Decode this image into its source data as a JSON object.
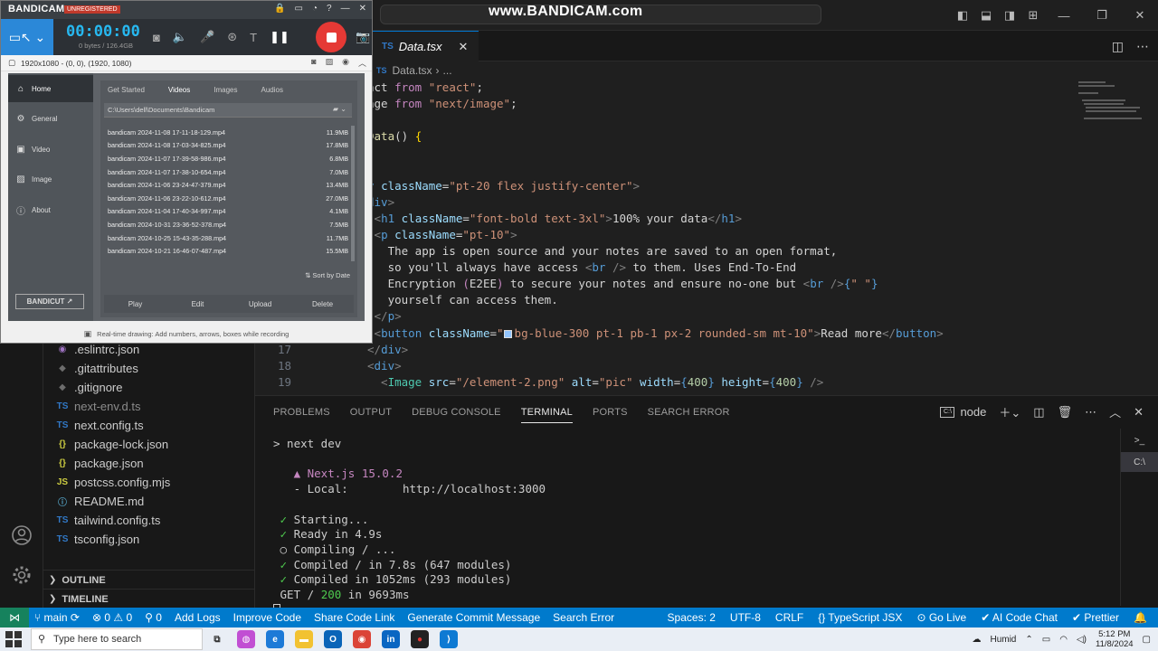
{
  "watermark": "www.BANDICAM.com",
  "vscode": {
    "tab": {
      "icon": "TS",
      "label": "Data.tsx",
      "close": "✕"
    },
    "breadcrumb": {
      "icon": "TS",
      "file": "Data.tsx",
      "sep": "›",
      "rest": "..."
    },
    "code": [
      {
        "n": "",
        "parts": [
          {
            "t": "act ",
            "c": "txt"
          },
          {
            "t": "from ",
            "c": "kw2"
          },
          {
            "t": "\"react\"",
            "c": "str"
          },
          {
            "t": ";",
            "c": "txt"
          }
        ]
      },
      {
        "n": "",
        "parts": [
          {
            "t": "age ",
            "c": "txt"
          },
          {
            "t": "from ",
            "c": "kw2"
          },
          {
            "t": "\"next/image\"",
            "c": "str"
          },
          {
            "t": ";",
            "c": "txt"
          }
        ]
      },
      {
        "n": "",
        "parts": []
      },
      {
        "n": "",
        "parts": [
          {
            "t": "Data",
            "c": "fn"
          },
          {
            "t": "() ",
            "c": "txt"
          },
          {
            "t": "{",
            "c": "br"
          }
        ]
      },
      {
        "n": "",
        "parts": [
          {
            "t": "(",
            "c": "kw2"
          }
        ]
      },
      {
        "n": "",
        "parts": []
      },
      {
        "n": "",
        "parts": [
          {
            "t": "v ",
            "c": "tag"
          },
          {
            "t": "className",
            "c": "attr"
          },
          {
            "t": "=",
            "c": "txt"
          },
          {
            "t": "\"pt-20 flex justify-center\"",
            "c": "str"
          },
          {
            "t": ">",
            "c": "gray"
          }
        ]
      },
      {
        "n": "",
        "parts": [
          {
            "t": "div",
            "c": "tag"
          },
          {
            "t": ">",
            "c": "gray"
          }
        ]
      },
      {
        "n": "",
        "parts": [
          {
            "t": " <",
            "c": "gray"
          },
          {
            "t": "h1 ",
            "c": "tag"
          },
          {
            "t": "className",
            "c": "attr"
          },
          {
            "t": "=",
            "c": "txt"
          },
          {
            "t": "\"font-bold text-3xl\"",
            "c": "str"
          },
          {
            "t": ">",
            "c": "gray"
          },
          {
            "t": "100% your data",
            "c": "txt"
          },
          {
            "t": "</",
            "c": "gray"
          },
          {
            "t": "h1",
            "c": "tag"
          },
          {
            "t": ">",
            "c": "gray"
          }
        ]
      },
      {
        "n": "",
        "parts": [
          {
            "t": " <",
            "c": "gray"
          },
          {
            "t": "p ",
            "c": "tag"
          },
          {
            "t": "className",
            "c": "attr"
          },
          {
            "t": "=",
            "c": "txt"
          },
          {
            "t": "\"pt-10\"",
            "c": "str"
          },
          {
            "t": ">",
            "c": "gray"
          }
        ]
      },
      {
        "n": "",
        "parts": [
          {
            "t": "   The app is open source and your notes are saved to an open format,",
            "c": "txt"
          }
        ]
      },
      {
        "n": "",
        "parts": [
          {
            "t": "   so you'll always have access ",
            "c": "txt"
          },
          {
            "t": "<",
            "c": "gray"
          },
          {
            "t": "br ",
            "c": "tag"
          },
          {
            "t": "/>",
            "c": "gray"
          },
          {
            "t": " to them. Uses End-To-End",
            "c": "txt"
          }
        ]
      },
      {
        "n": "",
        "parts": [
          {
            "t": "   Encryption ",
            "c": "txt"
          },
          {
            "t": "(",
            "c": "kw2"
          },
          {
            "t": "E2EE",
            "c": "txt"
          },
          {
            "t": ")",
            "c": "kw2"
          },
          {
            "t": " to secure your notes and ensure no-one but ",
            "c": "txt"
          },
          {
            "t": "<",
            "c": "gray"
          },
          {
            "t": "br ",
            "c": "tag"
          },
          {
            "t": "/>",
            "c": "gray"
          },
          {
            "t": "{",
            "c": "kw"
          },
          {
            "t": "\" \"",
            "c": "str"
          },
          {
            "t": "}",
            "c": "kw"
          }
        ]
      },
      {
        "n": "",
        "parts": [
          {
            "t": "   yourself can access them.",
            "c": "txt"
          }
        ]
      },
      {
        "n": "",
        "parts": [
          {
            "t": " </",
            "c": "gray"
          },
          {
            "t": "p",
            "c": "tag"
          },
          {
            "t": ">",
            "c": "gray"
          }
        ]
      },
      {
        "n": "",
        "parts": [
          {
            "t": " <",
            "c": "gray"
          },
          {
            "t": "button ",
            "c": "tag"
          },
          {
            "t": "className",
            "c": "attr"
          },
          {
            "t": "=",
            "c": "txt"
          },
          {
            "t": "\"",
            "c": "str"
          },
          {
            "t": "",
            "c": "swatch"
          },
          {
            "t": "bg-blue-300 pt-1 pb-1 px-2 rounded-sm mt-10\"",
            "c": "str"
          },
          {
            "t": ">",
            "c": "gray"
          },
          {
            "t": "Read more",
            "c": "txt"
          },
          {
            "t": "</",
            "c": "gray"
          },
          {
            "t": "button",
            "c": "tag"
          },
          {
            "t": ">",
            "c": "gray"
          }
        ]
      },
      {
        "n": "17",
        "parts": [
          {
            "t": "</",
            "c": "gray"
          },
          {
            "t": "div",
            "c": "tag"
          },
          {
            "t": ">",
            "c": "gray"
          }
        ]
      },
      {
        "n": "18",
        "parts": [
          {
            "t": "<",
            "c": "gray"
          },
          {
            "t": "div",
            "c": "tag"
          },
          {
            "t": ">",
            "c": "gray"
          }
        ]
      },
      {
        "n": "19",
        "parts": [
          {
            "t": "  <",
            "c": "gray"
          },
          {
            "t": "Image ",
            "c": "comp"
          },
          {
            "t": "src",
            "c": "attr"
          },
          {
            "t": "=",
            "c": "txt"
          },
          {
            "t": "\"/element-2.png\" ",
            "c": "str"
          },
          {
            "t": "alt",
            "c": "attr"
          },
          {
            "t": "=",
            "c": "txt"
          },
          {
            "t": "\"pic\" ",
            "c": "str"
          },
          {
            "t": "width",
            "c": "attr"
          },
          {
            "t": "=",
            "c": "txt"
          },
          {
            "t": "{",
            "c": "kw"
          },
          {
            "t": "400",
            "c": "num"
          },
          {
            "t": "} ",
            "c": "kw"
          },
          {
            "t": "height",
            "c": "attr"
          },
          {
            "t": "=",
            "c": "txt"
          },
          {
            "t": "{",
            "c": "kw"
          },
          {
            "t": "400",
            "c": "num"
          },
          {
            "t": "}",
            "c": "kw"
          },
          {
            "t": " />",
            "c": "gray"
          }
        ]
      }
    ],
    "files": [
      {
        "icon": "◉",
        "color": "#a074c4",
        "name": ".eslintrc.json"
      },
      {
        "icon": "◆",
        "color": "#6d6d6d",
        "name": ".gitattributes"
      },
      {
        "icon": "◆",
        "color": "#6d6d6d",
        "name": ".gitignore"
      },
      {
        "icon": "TS",
        "color": "#3178c6",
        "name": "next-env.d.ts",
        "dim": true
      },
      {
        "icon": "TS",
        "color": "#3178c6",
        "name": "next.config.ts"
      },
      {
        "icon": "{}",
        "color": "#cbcb41",
        "name": "package-lock.json"
      },
      {
        "icon": "{}",
        "color": "#cbcb41",
        "name": "package.json"
      },
      {
        "icon": "JS",
        "color": "#cbcb41",
        "name": "postcss.config.mjs"
      },
      {
        "icon": "ⓘ",
        "color": "#519aba",
        "name": "README.md"
      },
      {
        "icon": "TS",
        "color": "#3178c6",
        "name": "tailwind.config.ts"
      },
      {
        "icon": "TS",
        "color": "#3178c6",
        "name": "tsconfig.json"
      }
    ],
    "sections": {
      "outline": "OUTLINE",
      "timeline": "TIMELINE"
    },
    "panel": {
      "tabs": [
        "PROBLEMS",
        "OUTPUT",
        "DEBUG CONSOLE",
        "TERMINAL",
        "PORTS",
        "SEARCH ERROR"
      ],
      "active": "TERMINAL",
      "shell": "node"
    },
    "terminal": [
      {
        "parts": [
          {
            "t": "> next dev",
            "c": ""
          }
        ]
      },
      {
        "parts": []
      },
      {
        "parts": [
          {
            "t": "   ▲ Next.js 15.0.2",
            "c": "magenta"
          }
        ]
      },
      {
        "parts": [
          {
            "t": "   - Local:        http://localhost:3000",
            "c": ""
          }
        ]
      },
      {
        "parts": []
      },
      {
        "parts": [
          {
            "t": " ✓ ",
            "c": "green"
          },
          {
            "t": "Starting...",
            "c": ""
          }
        ]
      },
      {
        "parts": [
          {
            "t": " ✓ ",
            "c": "green"
          },
          {
            "t": "Ready in 4.9s",
            "c": ""
          }
        ]
      },
      {
        "parts": [
          {
            "t": " ○ Compiling / ...",
            "c": ""
          }
        ]
      },
      {
        "parts": [
          {
            "t": " ✓ ",
            "c": "green"
          },
          {
            "t": "Compiled / in 7.8s (647 modules)",
            "c": ""
          }
        ]
      },
      {
        "parts": [
          {
            "t": " ✓ ",
            "c": "green"
          },
          {
            "t": "Compiled in 1052ms (293 modules)",
            "c": ""
          }
        ]
      },
      {
        "parts": [
          {
            "t": " GET / ",
            "c": ""
          },
          {
            "t": "200",
            "c": "green"
          },
          {
            "t": " in 9693ms",
            "c": ""
          }
        ]
      }
    ],
    "status": {
      "remote": "⋈",
      "branch": "main",
      "sync": "⟳",
      "errors": "⊗ 0 ⚠ 0",
      "ports": "⚲ 0",
      "left_items": [
        "Add Logs",
        "Improve Code",
        "Share Code Link",
        "Generate Commit Message",
        "Search Error"
      ],
      "right_items": [
        "Spaces: 2",
        "UTF-8",
        "CRLF",
        "{} TypeScript JSX",
        "⊙ Go Live",
        "✔ AI Code Chat",
        "✔ Prettier",
        "🔔"
      ]
    }
  },
  "taskbar": {
    "search_placeholder": "Type here to search",
    "weather": "Humid",
    "time": "5:12 PM",
    "date": "11/8/2024",
    "apps": [
      {
        "name": "task-view",
        "label": "⧉",
        "bg": "transparent",
        "fg": "#333"
      },
      {
        "name": "copilot",
        "label": "◍",
        "bg": "#c14fd3",
        "fg": "#fff"
      },
      {
        "name": "edge",
        "label": "e",
        "bg": "#1d7ad7",
        "fg": "#fff"
      },
      {
        "name": "file-explorer",
        "label": "▬",
        "bg": "#f2c232",
        "fg": "#fff"
      },
      {
        "name": "outlook",
        "label": "O",
        "bg": "#0a64b8",
        "fg": "#fff"
      },
      {
        "name": "chrome",
        "label": "◉",
        "bg": "#db4437",
        "fg": "#fff"
      },
      {
        "name": "linkedin",
        "label": "in",
        "bg": "#0a66c2",
        "fg": "#fff"
      },
      {
        "name": "bandicam",
        "label": "●",
        "bg": "#222",
        "fg": "#e53935"
      },
      {
        "name": "vscode",
        "label": "⟩",
        "bg": "#0e7ad3",
        "fg": "#fff"
      }
    ]
  },
  "bandicam": {
    "logo": "BANDICAM",
    "unregistered": "UNREGISTERED",
    "timer": "00:00:00",
    "size": "0 bytes / 126.4GB",
    "resolution": "1920x1080 - (0, 0), (1920, 1080)",
    "nav": [
      "Home",
      "General",
      "Video",
      "Image",
      "About"
    ],
    "nav_icons": [
      "⌂",
      "⚙",
      "▣",
      "▨",
      "ⓘ"
    ],
    "tabs": [
      "Get Started",
      "Videos",
      "Images",
      "Audios"
    ],
    "active_tab": "Videos",
    "path": "C:\\Users\\dell\\Documents\\Bandicam",
    "files": [
      {
        "name": "bandicam 2024-11-08 17-11-18-129.mp4",
        "size": "11.9MB"
      },
      {
        "name": "bandicam 2024-11-08 17-03-34-825.mp4",
        "size": "17.8MB"
      },
      {
        "name": "bandicam 2024-11-07 17-39-58-986.mp4",
        "size": "6.8MB"
      },
      {
        "name": "bandicam 2024-11-07 17-38-10-654.mp4",
        "size": "7.0MB"
      },
      {
        "name": "bandicam 2024-11-06 23-24-47-379.mp4",
        "size": "13.4MB"
      },
      {
        "name": "bandicam 2024-11-06 23-22-10-612.mp4",
        "size": "27.0MB"
      },
      {
        "name": "bandicam 2024-11-04 17-40-34-997.mp4",
        "size": "4.1MB"
      },
      {
        "name": "bandicam 2024-10-31 23-36-52-378.mp4",
        "size": "7.5MB"
      },
      {
        "name": "bandicam 2024-10-25 15-43-35-288.mp4",
        "size": "11.7MB"
      },
      {
        "name": "bandicam 2024-10-21 16-46-07-487.mp4",
        "size": "15.5MB"
      }
    ],
    "sort": "Sort by Date",
    "actions": [
      "Play",
      "Edit",
      "Upload",
      "Delete"
    ],
    "bandicut": "BANDICUT ↗",
    "footer": "Real-time drawing: Add numbers, arrows, boxes while recording"
  }
}
